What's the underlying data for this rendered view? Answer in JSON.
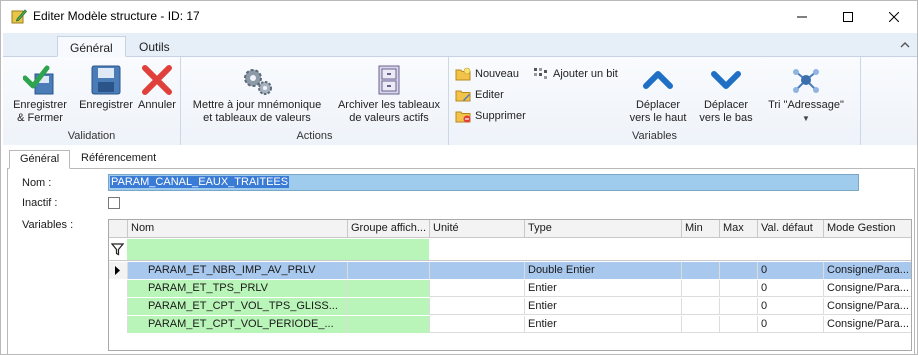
{
  "window": {
    "title": "Editer Modèle structure - ID: 17",
    "min_label": "—",
    "max_label": "☐",
    "close_label": "✕"
  },
  "ribbon": {
    "tabs": [
      {
        "label": "Général",
        "active": true
      },
      {
        "label": "Outils",
        "active": false
      }
    ],
    "groups": {
      "validation": {
        "label": "Validation",
        "buttons": [
          {
            "label": "Enregistrer\n& Fermer",
            "icon": "save-close-icon"
          },
          {
            "label": "Enregistrer",
            "icon": "floppy-icon"
          },
          {
            "label": "Annuler",
            "icon": "cancel-x-icon"
          }
        ]
      },
      "actions": {
        "label": "Actions",
        "buttons": [
          {
            "label": "Mettre à jour mnémonique\net tableaux de valeurs",
            "icon": "gears-icon"
          },
          {
            "label": "Archiver les tableaux\nde valeurs actifs",
            "icon": "file-cabinet-icon"
          }
        ]
      },
      "variables": {
        "label": "Variables",
        "small": [
          {
            "label": "Nouveau",
            "icon": "folder-new-icon"
          },
          {
            "label": "Editer",
            "icon": "folder-edit-icon"
          },
          {
            "label": "Supprimer",
            "icon": "folder-delete-icon"
          },
          {
            "label": "Ajouter un bit",
            "icon": "bits-icon"
          }
        ],
        "buttons": [
          {
            "label": "Déplacer\nvers le haut",
            "icon": "chevron-up-icon"
          },
          {
            "label": "Déplacer\nvers le bas",
            "icon": "chevron-down-icon"
          },
          {
            "label": "Tri \"Adressage\"",
            "icon": "network-icon"
          }
        ]
      }
    }
  },
  "form_tabs": [
    {
      "label": "Général",
      "active": true
    },
    {
      "label": "Référencement",
      "active": false
    }
  ],
  "form": {
    "name_label": "Nom :",
    "name_value": "PARAM_CANAL_EAUX_TRAITEES",
    "inactive_label": "Inactif :",
    "variables_label": "Variables :"
  },
  "grid": {
    "columns": [
      "Nom",
      "Groupe affich...",
      "Unité",
      "Type",
      "Min",
      "Max",
      "Val. défaut",
      "Mode Gestion"
    ],
    "rows": [
      {
        "nom": "PARAM_ET_NBR_IMP_AV_PRLV",
        "groupe": "",
        "unite": "",
        "type": "Double Entier",
        "min": "",
        "max": "",
        "defaut": "0",
        "mode": "Consigne/Para...",
        "selected": true
      },
      {
        "nom": "PARAM_ET_TPS_PRLV",
        "groupe": "",
        "unite": "",
        "type": "Entier",
        "min": "",
        "max": "",
        "defaut": "0",
        "mode": "Consigne/Para...",
        "selected": false
      },
      {
        "nom": "PARAM_ET_CPT_VOL_TPS_GLISS...",
        "groupe": "",
        "unite": "",
        "type": "Entier",
        "min": "",
        "max": "",
        "defaut": "0",
        "mode": "Consigne/Para...",
        "selected": false
      },
      {
        "nom": "PARAM_ET_CPT_VOL_PERIODE_...",
        "groupe": "",
        "unite": "",
        "type": "Entier",
        "min": "",
        "max": "",
        "defaut": "0",
        "mode": "Consigne/Para...",
        "selected": false
      }
    ]
  },
  "colors": {
    "accent_blue": "#1f6fc5",
    "ok_green": "#2ea44f",
    "cancel_red": "#e0403c",
    "row_green": "#b9f5b9",
    "row_selected": "#a8c8ee"
  }
}
